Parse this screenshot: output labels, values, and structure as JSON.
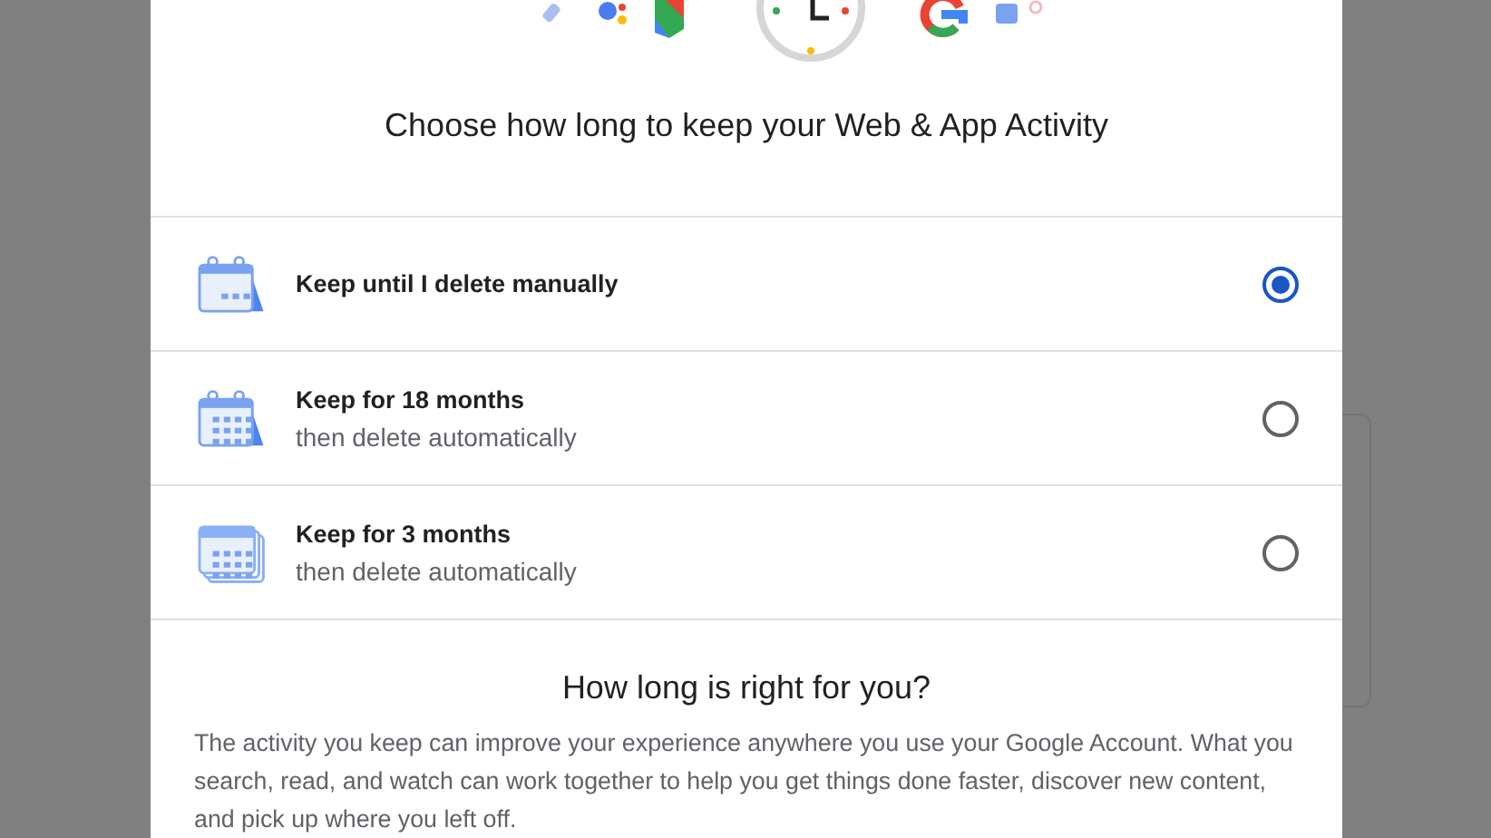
{
  "dialog": {
    "title": "Choose how long to keep your Web & App Activity",
    "options": [
      {
        "kind": "manual",
        "title": "Keep until I delete manually",
        "selected": true
      },
      {
        "kind": "months18",
        "title": "Keep for 18 months",
        "subtitle": "then delete automatically",
        "selected": false
      },
      {
        "kind": "months3",
        "title": "Keep for 3 months",
        "subtitle": "then delete automatically",
        "selected": false
      }
    ],
    "info": {
      "heading": "How long is right for you?",
      "text": "The activity you keep can improve your experience anywhere you use your Google Account. What you search, read, and watch can work together to help you get things done faster, discover new content, and pick up where you left off."
    }
  }
}
